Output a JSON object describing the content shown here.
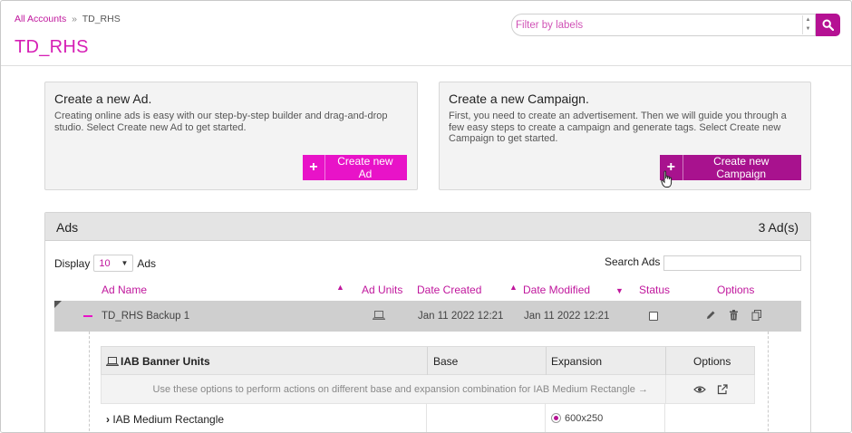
{
  "breadcrumb": {
    "root": "All Accounts",
    "separator": "»",
    "current": "TD_RHS"
  },
  "page_title": "TD_RHS",
  "search": {
    "placeholder": "Filter by labels"
  },
  "cards": {
    "ad": {
      "title": "Create a new Ad.",
      "desc": "Creating online ads is easy with our step-by-step builder and drag-and-drop studio. Select Create new Ad to get started.",
      "button": "Create new Ad"
    },
    "campaign": {
      "title": "Create a new Campaign.",
      "desc": "First, you need to create an advertisement. Then we will guide you through a few easy steps to create a campaign and generate tags. Select Create new Campaign to get started.",
      "button": "Create new Campaign"
    }
  },
  "ads": {
    "title": "Ads",
    "count": "3 Ad(s)",
    "display_label": "Display",
    "display_value": "10",
    "display_suffix": "Ads",
    "search_label": "Search Ads :",
    "columns": {
      "name": "Ad Name",
      "units": "Ad Units",
      "created": "Date Created",
      "modified": "Date Modified",
      "status": "Status",
      "options": "Options"
    },
    "rows": [
      {
        "name": "TD_RHS Backup 1",
        "created": "Jan 11 2022 12:21",
        "modified": "Jan 11 2022 12:21"
      }
    ]
  },
  "iab": {
    "columns": {
      "units": "IAB Banner Units",
      "base": "Base",
      "expansion": "Expansion",
      "options": "Options"
    },
    "hint": "Use these options to perform actions on different base and expansion combination for IAB Medium Rectangle",
    "row": {
      "name": "IAB Medium Rectangle",
      "size": "600x250"
    }
  },
  "colors": {
    "accent": "#e813c8",
    "accent_dark": "#b51193",
    "link": "#c0179d"
  }
}
